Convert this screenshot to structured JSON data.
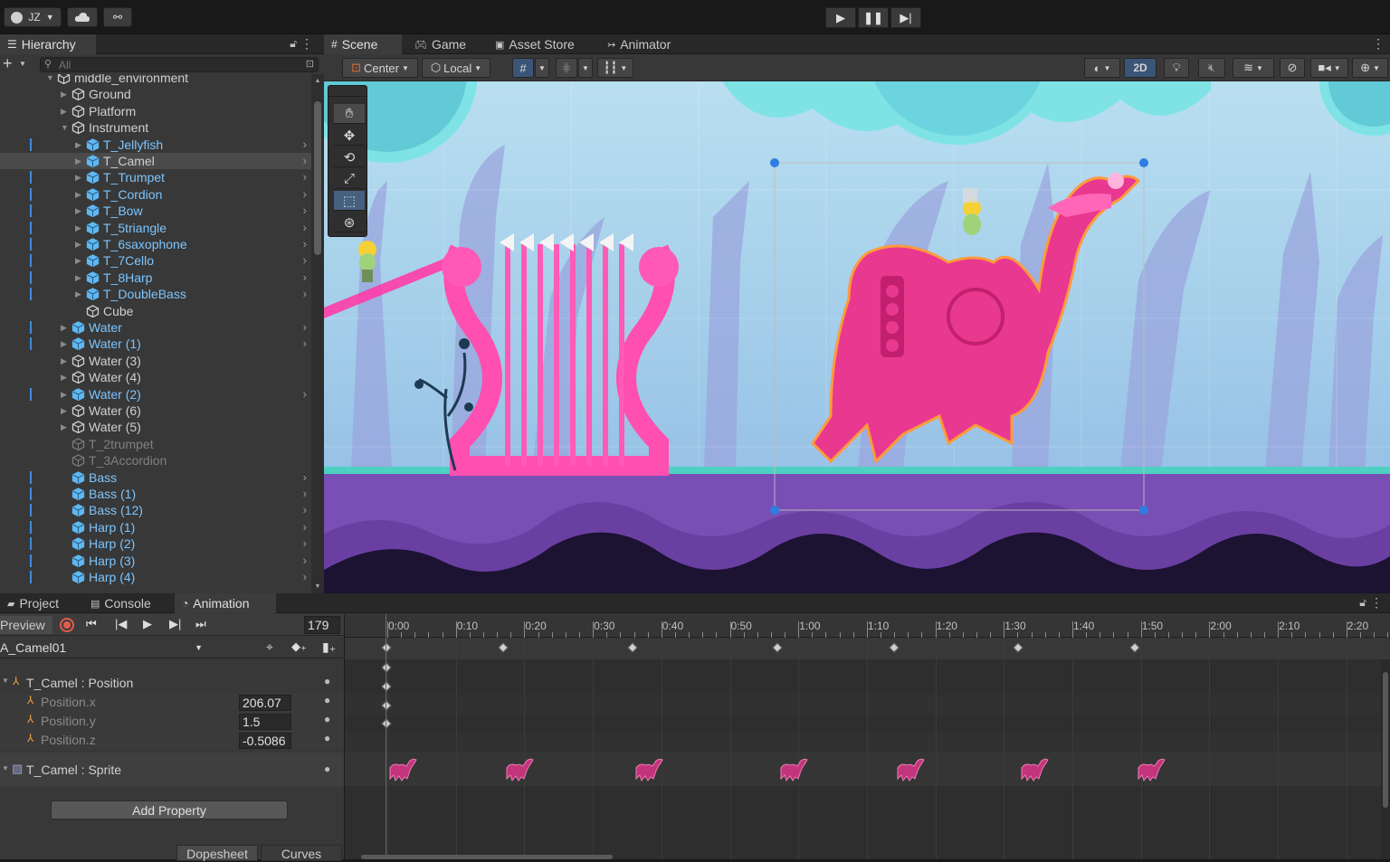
{
  "toolbar": {
    "account": "JZ",
    "account_icon": "account-icon",
    "cloud_icon": "cloud-icon",
    "collab_icon": "collab-icon",
    "play_icon": "play-icon",
    "pause_icon": "pause-icon",
    "step_icon": "step-icon"
  },
  "hierarchy": {
    "tab_label": "Hierarchy",
    "search_placeholder": "All",
    "items": [
      {
        "label": "middle_environment",
        "indent": 1,
        "expanded": true,
        "kind": "grey-cube",
        "style": "normal"
      },
      {
        "label": "Ground",
        "indent": 2,
        "kind": "grey-cube",
        "style": "normal",
        "arrow": true
      },
      {
        "label": "Platform",
        "indent": 2,
        "kind": "grey-cube",
        "style": "normal",
        "arrow": true
      },
      {
        "label": "Instrument",
        "indent": 2,
        "expanded": true,
        "kind": "grey-cube",
        "style": "normal"
      },
      {
        "label": "T_Jellyfish",
        "indent": 3,
        "kind": "blue-cube",
        "style": "blue",
        "arrow": true,
        "chevron": true
      },
      {
        "label": "T_Camel",
        "indent": 3,
        "kind": "blue-cube",
        "style": "normal",
        "arrow": true,
        "chevron": true,
        "selected": true
      },
      {
        "label": "T_Trumpet",
        "indent": 3,
        "kind": "blue-cube",
        "style": "blue",
        "arrow": true,
        "chevron": true
      },
      {
        "label": "T_Cordion",
        "indent": 3,
        "kind": "blue-cube",
        "style": "blue",
        "arrow": true,
        "chevron": true
      },
      {
        "label": "T_Bow",
        "indent": 3,
        "kind": "blue-cube",
        "style": "blue",
        "arrow": true,
        "chevron": true
      },
      {
        "label": "T_5triangle",
        "indent": 3,
        "kind": "blue-cube",
        "style": "blue",
        "arrow": true,
        "chevron": true
      },
      {
        "label": "T_6saxophone",
        "indent": 3,
        "kind": "blue-cube",
        "style": "blue",
        "arrow": true,
        "chevron": true
      },
      {
        "label": "T_7Cello",
        "indent": 3,
        "kind": "blue-cube",
        "style": "blue",
        "arrow": true,
        "chevron": true
      },
      {
        "label": "T_8Harp",
        "indent": 3,
        "kind": "blue-cube",
        "style": "blue",
        "arrow": true,
        "chevron": true
      },
      {
        "label": "T_DoubleBass",
        "indent": 3,
        "kind": "blue-cube",
        "style": "blue",
        "arrow": true,
        "chevron": true
      },
      {
        "label": "Cube",
        "indent": 3,
        "kind": "grey-cube",
        "style": "normal"
      },
      {
        "label": "Water",
        "indent": 2,
        "kind": "blue-cube",
        "style": "blue",
        "arrow": true,
        "chevron": true
      },
      {
        "label": "Water (1)",
        "indent": 2,
        "kind": "blue-cube",
        "style": "blue",
        "arrow": true,
        "chevron": true
      },
      {
        "label": "Water (3)",
        "indent": 2,
        "kind": "grey-cube",
        "style": "normal",
        "arrow": true
      },
      {
        "label": "Water (4)",
        "indent": 2,
        "kind": "grey-cube",
        "style": "normal",
        "arrow": true
      },
      {
        "label": "Water (2)",
        "indent": 2,
        "kind": "blue-cube",
        "style": "blue",
        "arrow": true,
        "chevron": true
      },
      {
        "label": "Water (6)",
        "indent": 2,
        "kind": "grey-cube",
        "style": "normal",
        "arrow": true
      },
      {
        "label": "Water (5)",
        "indent": 2,
        "kind": "grey-cube",
        "style": "normal",
        "arrow": true
      },
      {
        "label": "T_2trumpet",
        "indent": 2,
        "kind": "grey-cube",
        "style": "grey"
      },
      {
        "label": "T_3Accordion",
        "indent": 2,
        "kind": "grey-cube",
        "style": "grey"
      },
      {
        "label": "Bass",
        "indent": 2,
        "kind": "blue-cube",
        "style": "blue",
        "chevron": true
      },
      {
        "label": "Bass (1)",
        "indent": 2,
        "kind": "blue-cube",
        "style": "blue",
        "chevron": true
      },
      {
        "label": "Bass (12)",
        "indent": 2,
        "kind": "blue-cube",
        "style": "blue",
        "chevron": true
      },
      {
        "label": "Harp (1)",
        "indent": 2,
        "kind": "blue-cube",
        "style": "blue",
        "chevron": true
      },
      {
        "label": "Harp (2)",
        "indent": 2,
        "kind": "blue-cube",
        "style": "blue",
        "chevron": true
      },
      {
        "label": "Harp (3)",
        "indent": 2,
        "kind": "blue-cube",
        "style": "blue",
        "chevron": true
      },
      {
        "label": "Harp (4)",
        "indent": 2,
        "kind": "blue-cube",
        "style": "blue",
        "chevron": true
      }
    ]
  },
  "scene": {
    "tabs": [
      {
        "label": "Scene",
        "icon": "grid-icon"
      },
      {
        "label": "Game",
        "icon": "gamepad-icon"
      },
      {
        "label": "Asset Store",
        "icon": "bag-icon"
      },
      {
        "label": "Animator",
        "icon": "animator-icon"
      }
    ],
    "pivot": "Center",
    "space": "Local",
    "mode_2d": "2D",
    "tools": [
      "hand-icon",
      "move-icon",
      "rotate-icon",
      "scale-icon",
      "rect-icon",
      "transform-icon"
    ]
  },
  "bottom": {
    "tabs": [
      {
        "label": "Project",
        "icon": "folder-icon"
      },
      {
        "label": "Console",
        "icon": "console-icon"
      },
      {
        "label": "Animation",
        "icon": "animation-icon"
      }
    ],
    "preview_label": "Preview",
    "frame": "179",
    "clip": "A_Camel01",
    "properties": [
      {
        "label": "T_Camel : Position",
        "type": "group"
      },
      {
        "label": "Position.x",
        "value": "206.07"
      },
      {
        "label": "Position.y",
        "value": "1.5"
      },
      {
        "label": "Position.z",
        "value": "-0.5086"
      },
      {
        "label": "T_Camel : Sprite",
        "type": "group"
      }
    ],
    "add_property": "Add Property",
    "dopesheet": "Dopesheet",
    "curves": "Curves",
    "timeline_ticks": [
      "0:00",
      "0:10",
      "0:20",
      "0:30",
      "0:40",
      "0:50",
      "1:00",
      "1:10",
      "1:20",
      "1:30",
      "1:40",
      "1:50",
      "2:00",
      "2:10",
      "2:20"
    ]
  }
}
